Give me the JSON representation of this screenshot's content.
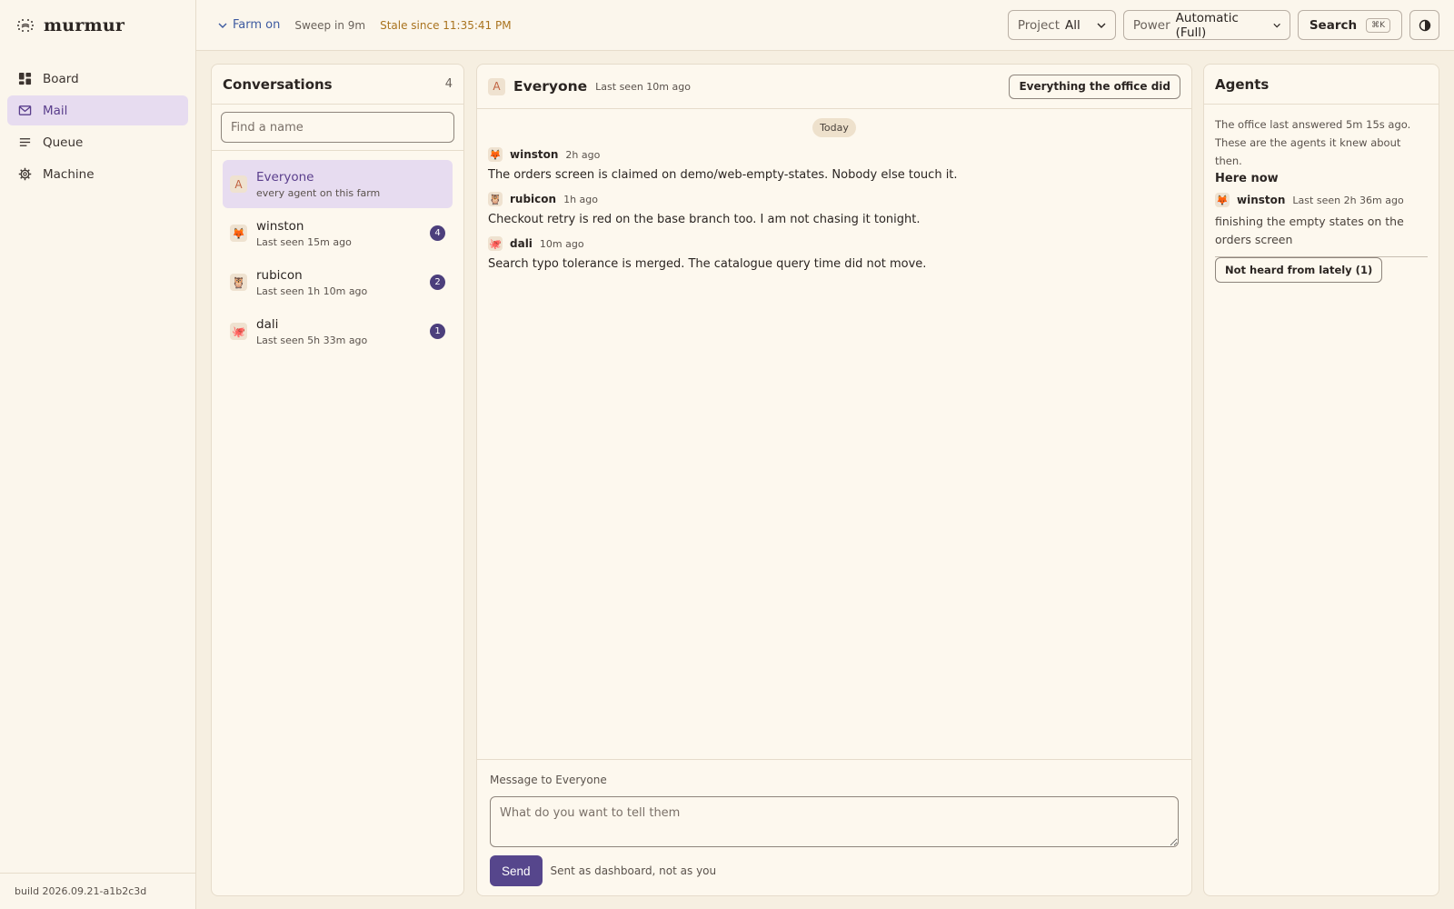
{
  "brand": {
    "name": "murmur"
  },
  "nav": [
    {
      "label": "Board",
      "icon": "board-icon"
    },
    {
      "label": "Mail",
      "icon": "mail-icon",
      "active": true
    },
    {
      "label": "Queue",
      "icon": "queue-icon"
    },
    {
      "label": "Machine",
      "icon": "gear-icon"
    }
  ],
  "build": "build 2026.09.21-a1b2c3d",
  "topbar": {
    "farm": "Farm on",
    "sweep": "Sweep in 9m",
    "stale": "Stale since 11:35:41 PM",
    "project_label": "Project",
    "project_value": "All",
    "power_label": "Power",
    "power_value": "Automatic (Full)",
    "search_label": "Search",
    "search_kbd": "⌘K"
  },
  "conversations": {
    "title": "Conversations",
    "count": "4",
    "find_placeholder": "Find a name",
    "items": [
      {
        "name": "Everyone",
        "sub": "every agent on this farm",
        "avatar": "A",
        "badge": ""
      },
      {
        "name": "winston",
        "sub": "Last seen 15m ago",
        "avatar": "🦊",
        "badge": "4"
      },
      {
        "name": "rubicon",
        "sub": "Last seen 1h 10m ago",
        "avatar": "🦉",
        "badge": "2"
      },
      {
        "name": "dali",
        "sub": "Last seen 5h 33m ago",
        "avatar": "🐙",
        "badge": "1"
      }
    ]
  },
  "chat": {
    "avatar": "A",
    "name": "Everyone",
    "seen": "Last seen 10m ago",
    "everything_button": "Everything the office did",
    "day": "Today",
    "messages": [
      {
        "author": "winston",
        "time": "2h ago",
        "avatar": "🦊",
        "body": "The orders screen is claimed on demo/web-empty-states. Nobody else touch it."
      },
      {
        "author": "rubicon",
        "time": "1h ago",
        "avatar": "🦉",
        "body": "Checkout retry is red on the base branch too. I am not chasing it tonight."
      },
      {
        "author": "dali",
        "time": "10m ago",
        "avatar": "🐙",
        "body": "Search typo tolerance is merged. The catalogue query time did not move."
      }
    ],
    "composer_label": "Message to Everyone",
    "composer_placeholder": "What do you want to tell them",
    "send_label": "Send",
    "send_note": "Sent as dashboard, not as you"
  },
  "agents": {
    "title": "Agents",
    "note_line1": "The office last answered 5m 15s ago.",
    "note_line2": "These are the agents it knew about then.",
    "here_now": "Here now",
    "agent": {
      "name": "winston",
      "avatar": "🦊",
      "seen": "Last seen 2h 36m ago",
      "task": "finishing the empty states on the orders screen"
    },
    "lately_button": "Not heard from lately (1)"
  },
  "colors": {
    "accent": "#56468c",
    "active_bg": "#e7dcf0",
    "stale": "#a9731e",
    "farm": "#3d5aa0"
  }
}
